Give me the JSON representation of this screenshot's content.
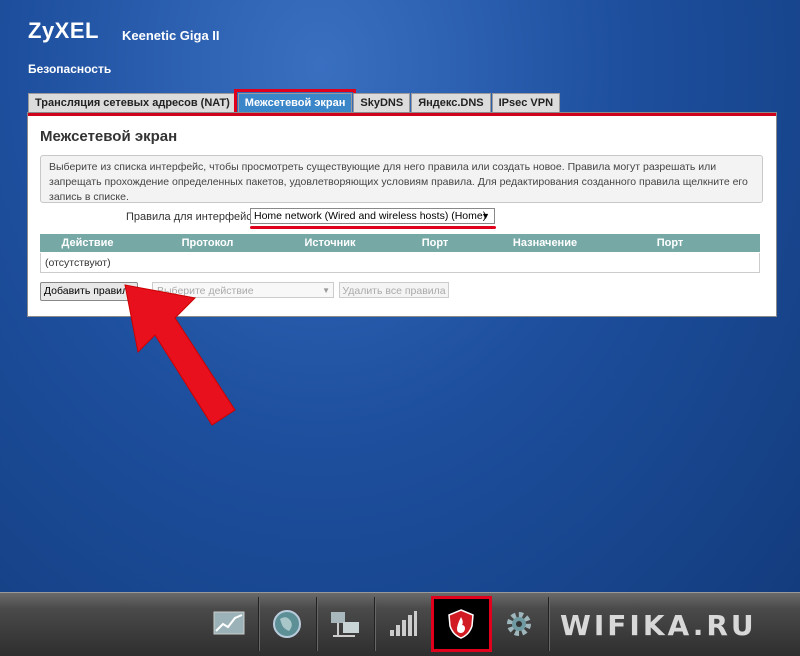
{
  "header": {
    "brand": "ZyXEL",
    "model": "Keenetic Giga II",
    "section": "Безопасность"
  },
  "tabs": [
    {
      "label": "Трансляция сетевых адресов (NAT)",
      "active": false
    },
    {
      "label": "Межсетевой экран",
      "active": true
    },
    {
      "label": "SkyDNS",
      "active": false
    },
    {
      "label": "Яндекс.DNS",
      "active": false
    },
    {
      "label": "IPsec VPN",
      "active": false
    }
  ],
  "panel": {
    "title": "Межсетевой экран",
    "info": "Выберите из списка интерфейс, чтобы просмотреть существующие для него правила или создать новое. Правила могут разрешать или запрещать прохождение определенных пакетов, удовлетворяющих условиям правила. Для редактирования созданного правила щелкните его запись в списке.",
    "interface_label": "Правила для интерфейса:",
    "interface_value": "Home network (Wired and wireless hosts) (Home)",
    "table": {
      "columns": [
        "Действие",
        "Протокол",
        "Источник",
        "Порт",
        "Назначение",
        "Порт"
      ],
      "empty_text": "(отсутствуют)"
    },
    "add_button": "Добавить правило",
    "action_placeholder": "Выберите действие",
    "delete_all_button": "Удалить все правила"
  },
  "taskbar": {
    "items": [
      "monitor-icon",
      "globe-icon",
      "network-icon",
      "wifi-signal-icon",
      "shield-icon",
      "gear-icon"
    ],
    "active": "shield-icon",
    "watermark": "WIFIKA.RU"
  },
  "colors": {
    "accent_red": "#e0001b",
    "tab_active": "#3b86c8",
    "table_header": "#76a8a6",
    "background": "#1d4f9e"
  }
}
